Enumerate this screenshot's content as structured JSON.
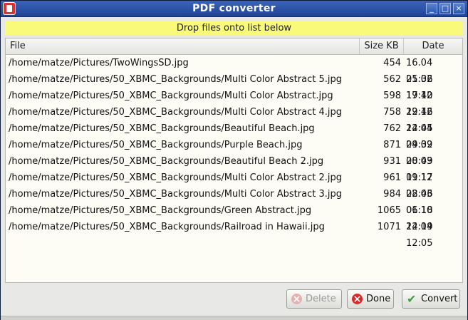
{
  "window": {
    "title": "PDF converter",
    "minimize_label": "_",
    "maximize_label": "□",
    "close_label": "×"
  },
  "drop_banner": "Drop files onto list below",
  "columns": {
    "file": "File",
    "size": "Size KB",
    "date": "Date"
  },
  "files": [
    {
      "path": "/home/matze/Pictures/TwoWingsSD.jpg",
      "size": "454",
      "date": "16.04 01:36"
    },
    {
      "path": "/home/matze/Pictures/50_XBMC_Backgrounds/Multi Color Abstract 5.jpg",
      "size": "562",
      "date": "25.02 17:40"
    },
    {
      "path": "/home/matze/Pictures/50_XBMC_Backgrounds/Multi Color Abstract.jpg",
      "size": "598",
      "date": "19.12 22:46"
    },
    {
      "path": "/home/matze/Pictures/50_XBMC_Backgrounds/Multi Color Abstract 4.jpg",
      "size": "758",
      "date": "19.12 22:45"
    },
    {
      "path": "/home/matze/Pictures/50_XBMC_Backgrounds/Beautiful Beach.jpg",
      "size": "762",
      "date": "14.04 09:32"
    },
    {
      "path": "/home/matze/Pictures/50_XBMC_Backgrounds/Purple Beach.jpg",
      "size": "871",
      "date": "24.09 20:49"
    },
    {
      "path": "/home/matze/Pictures/50_XBMC_Backgrounds/Beautiful Beach 2.jpg",
      "size": "931",
      "date": "08.03 01:17"
    },
    {
      "path": "/home/matze/Pictures/50_XBMC_Backgrounds/Multi Color Abstract 2.jpg",
      "size": "961",
      "date": "19.12 22:46"
    },
    {
      "path": "/home/matze/Pictures/50_XBMC_Backgrounds/Multi Color Abstract 3.jpg",
      "size": "984",
      "date": "08.03 01:18"
    },
    {
      "path": "/home/matze/Pictures/50_XBMC_Backgrounds/Green Abstract.jpg",
      "size": "1065",
      "date": "06.10 22:19"
    },
    {
      "path": "/home/matze/Pictures/50_XBMC_Backgrounds/Railroad in Hawaii.jpg",
      "size": "1071",
      "date": "14.04 12:05"
    }
  ],
  "buttons": {
    "delete": {
      "label": "Delete",
      "icon": "delete-icon",
      "enabled": false
    },
    "done": {
      "label": "Done",
      "icon": "close-circle-icon",
      "enabled": true
    },
    "convert": {
      "label": "Convert",
      "icon": "checkmark-icon",
      "enabled": true
    }
  },
  "colors": {
    "titlebar": "#2a56b0",
    "banner": "#fafa7a",
    "list_bg": "#fdfdf5"
  }
}
